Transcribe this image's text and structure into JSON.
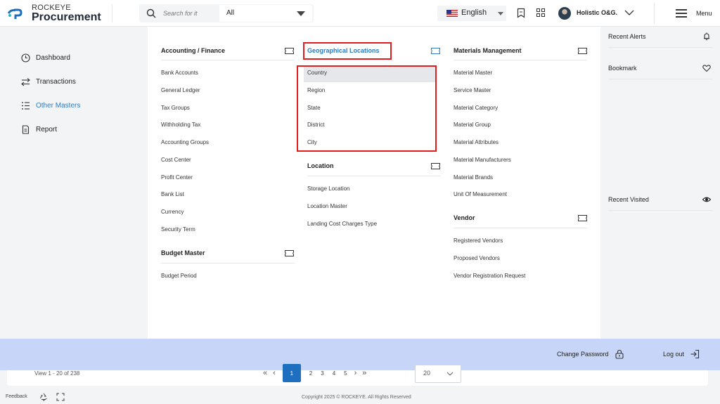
{
  "header": {
    "brand_top": "ROCKEYE",
    "brand_main": "Procurement",
    "search_placeholder": "Search for it",
    "filter_value": "All",
    "language": "English",
    "user_name": "Holistic O&G.",
    "menu_label": "Menu"
  },
  "sidebar": {
    "items": [
      {
        "label": "Dashboard",
        "icon": "clock-icon"
      },
      {
        "label": "Transactions",
        "icon": "swap-icon"
      },
      {
        "label": "Other Masters",
        "icon": "list-icon",
        "active": true
      },
      {
        "label": "Report",
        "icon": "document-icon"
      }
    ]
  },
  "mega": {
    "accounting": {
      "title": "Accounting / Finance",
      "links": [
        "Bank Accounts",
        "General Ledger",
        "Tax Groups",
        "Withholding Tax",
        "Accounting Groups",
        "Cost Center",
        "Profit Center",
        "Bank List",
        "Currency",
        "Security Term"
      ]
    },
    "budget": {
      "title": "Budget Master",
      "links": [
        "Budget Period"
      ]
    },
    "geo": {
      "title": "Geographical Locations",
      "links": [
        "Country",
        "Region",
        "State",
        "District",
        "City"
      ]
    },
    "location": {
      "title": "Location",
      "links": [
        "Storage Location",
        "Location Master",
        "Landing Cost Charges Type"
      ]
    },
    "materials": {
      "title": "Materials Management",
      "links": [
        "Material Master",
        "Service Master",
        "Material Category",
        "Material Group",
        "Material Attributes",
        "Material Manufacturers",
        "Material Brands",
        "Unit Of Measurement"
      ]
    },
    "vendor": {
      "title": "Vendor",
      "links": [
        "Registered Vendors",
        "Proposed Vendors",
        "Vendor Registration Request"
      ]
    }
  },
  "right_panel": {
    "recent_alerts": "Recent Alerts",
    "bookmark": "Bookmark",
    "recent_visited": "Recent Visited"
  },
  "bottom_bar": {
    "change_password": "Change Password",
    "log_out": "Log out"
  },
  "pagination": {
    "info": "View 1 - 20 of 238",
    "pages": [
      "1",
      "2",
      "3",
      "4",
      "5"
    ],
    "current_page": "1",
    "per_page": "20"
  },
  "footer": {
    "feedback": "Feedback",
    "copyright": "Copyright 2025 © ROCKEYE. All Rights Reserved"
  },
  "colors": {
    "accent": "#2b7bc2",
    "highlight_border": "#e11d1d",
    "bottom_bar": "#c7d6f8",
    "page_active": "#1e6fbf"
  }
}
